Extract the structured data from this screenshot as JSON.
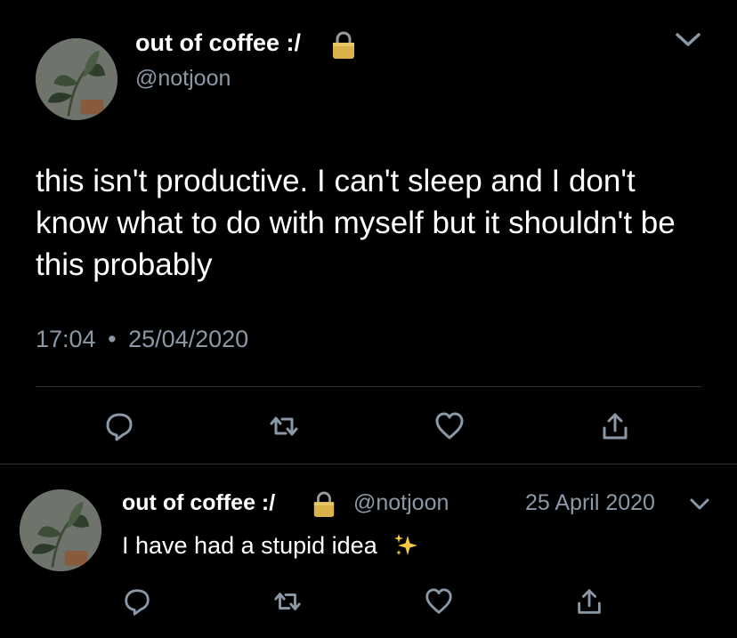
{
  "main_tweet": {
    "display_name": "out of coffee :/",
    "handle": "@notjoon",
    "text": "this isn't productive. I can't sleep and I don't know what to do with myself but it shouldn't be this probably",
    "time": "17:04",
    "separator": "•",
    "date": "25/04/2020",
    "icons": {
      "lock": "lock-icon",
      "menu": "chevron-down-icon",
      "reply": "reply-icon",
      "retweet": "retweet-icon",
      "like": "heart-icon",
      "share": "share-icon"
    }
  },
  "reply_tweet": {
    "display_name": "out of coffee :/",
    "handle": "@notjoon",
    "date": "25 April 2020",
    "text": "I have had a stupid idea",
    "emoji": "sparkles-emoji",
    "icons": {
      "lock": "lock-icon",
      "menu": "chevron-down-icon",
      "reply": "reply-icon",
      "retweet": "retweet-icon",
      "like": "heart-icon",
      "share": "share-icon"
    }
  },
  "colors": {
    "background": "#000000",
    "text": "#ffffff",
    "secondary": "#8b98a5",
    "divider": "#2f3336",
    "lock_gold": "#d9b24a"
  }
}
